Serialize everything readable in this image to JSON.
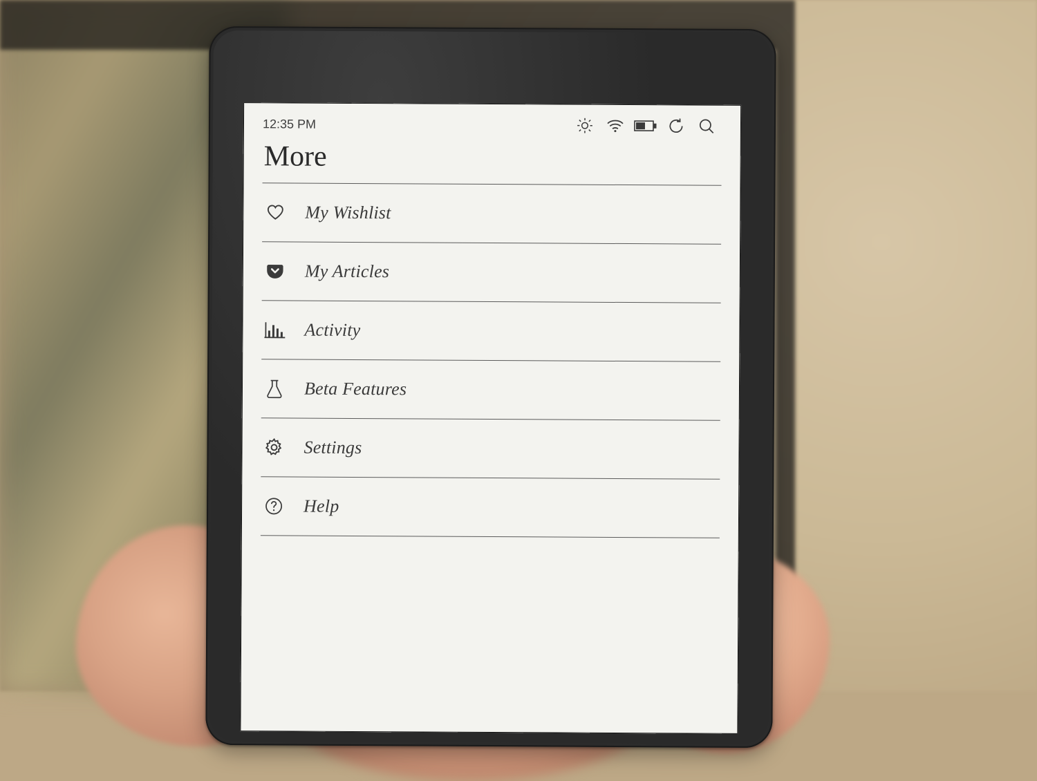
{
  "status": {
    "time": "12:35 PM",
    "icons": [
      "brightness",
      "wifi",
      "battery",
      "sync",
      "search"
    ]
  },
  "page": {
    "title": "More"
  },
  "menu": {
    "items": [
      {
        "icon": "heart",
        "label": "My Wishlist"
      },
      {
        "icon": "pocket",
        "label": "My Articles"
      },
      {
        "icon": "activity",
        "label": "Activity"
      },
      {
        "icon": "flask",
        "label": "Beta Features"
      },
      {
        "icon": "gear",
        "label": "Settings"
      },
      {
        "icon": "help",
        "label": "Help"
      }
    ]
  }
}
